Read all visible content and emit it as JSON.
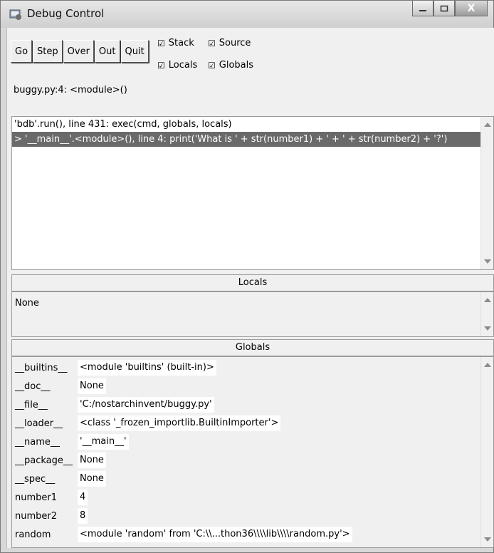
{
  "window": {
    "title": "Debug Control",
    "controls": {
      "minimize": "–",
      "maximize": "□",
      "close": "X"
    }
  },
  "toolbar": {
    "buttons": [
      "Go",
      "Step",
      "Over",
      "Out",
      "Quit"
    ]
  },
  "checkboxes": {
    "stack": {
      "label": "Stack",
      "checked": true,
      "mark": "☑"
    },
    "source": {
      "label": "Source",
      "checked": true,
      "mark": "☑"
    },
    "locals": {
      "label": "Locals",
      "checked": true,
      "mark": "☑"
    },
    "globals": {
      "label": "Globals",
      "checked": true,
      "mark": "☑"
    }
  },
  "location": "buggy.py:4: <module>()",
  "stack": {
    "rows": [
      {
        "text": "'bdb'.run(), line 431: exec(cmd, globals, locals)",
        "selected": false
      },
      {
        "text": "> '__main__'.<module>(), line 4: print('What is ' + str(number1) + ' + ' + str(number2) + '?')",
        "selected": true
      }
    ]
  },
  "locals": {
    "header": "Locals",
    "content": "None"
  },
  "globals": {
    "header": "Globals",
    "rows": [
      {
        "name": "__builtins__",
        "value": "<module 'builtins' (built-in)>"
      },
      {
        "name": "__doc__",
        "value": "None"
      },
      {
        "name": "__file__",
        "value": "'C:/nostarchinvent/buggy.py'"
      },
      {
        "name": "__loader__",
        "value": "<class '_frozen_importlib.BuiltinImporter'>"
      },
      {
        "name": "__name__",
        "value": "'__main__'"
      },
      {
        "name": "__package__",
        "value": "None"
      },
      {
        "name": "__spec__",
        "value": "None"
      },
      {
        "name": "number1",
        "value": "4"
      },
      {
        "name": "number2",
        "value": "8"
      },
      {
        "name": "random",
        "value": "<module 'random' from 'C:\\\\...thon36\\\\\\\\lib\\\\\\\\random.py'>"
      }
    ]
  }
}
